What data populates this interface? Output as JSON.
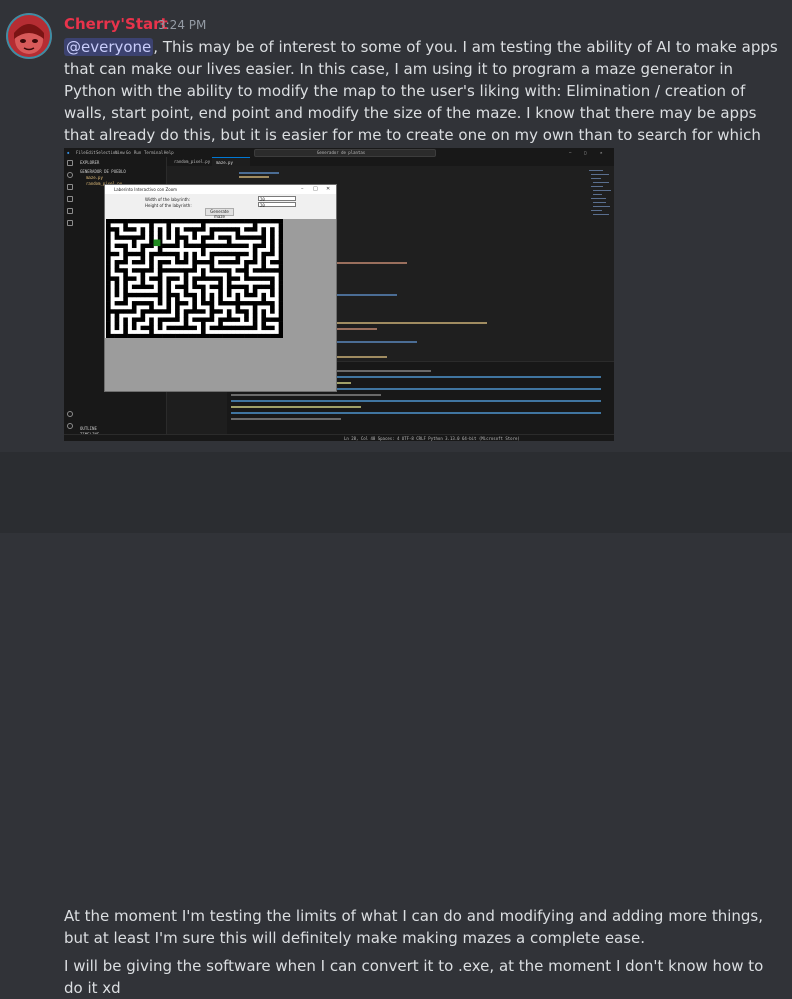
{
  "message1": {
    "author": "Cherry'Start",
    "timestamp": "3:24 PM",
    "author_color": "#e8334b",
    "mention": "@everyone",
    "text": ", This may be of interest to some of you. I am testing the ability of AI to make apps that can make our lives easier. In this case, I am using it to program a maze generator in Python with the ability to modify the map to the user's liking with: Elimination / creation of walls, start point, end point and modify the size of the maze. I know that there may be apps that already do this, but it is easier for me to create one on my own than to search for which one is most useful."
  },
  "attachment": {
    "title_menu": [
      "File",
      "Edit",
      "Selection",
      "View",
      "Go",
      "Run",
      "Terminal",
      "Help"
    ],
    "command_center": "Generador de plantas",
    "sidebar_title": "EXPLORER",
    "sidebar_folder": "GENERADOR DE PUEBLO",
    "sidebar_files": [
      "maze.py",
      "random_pixel.py"
    ],
    "sidebar_bottom": [
      "OUTLINE",
      "TIMELINE"
    ],
    "tabs": [
      "random_pixel.py",
      "maze.py"
    ],
    "tk_title": "Laberinto Interactivo con Zoom",
    "tk_width_label": "Width of the labyrinth:",
    "tk_height_label": "Height of the labyrinth:",
    "tk_width_value": "20",
    "tk_height_value": "20",
    "tk_button": "Generate maze",
    "status_right": "Ln 28, Col 48   Spaces: 4   UTF-8   CRLF   Python   3.13.0 64-bit (Microsoft Store)"
  },
  "message2": {
    "line1": "At the moment I'm testing the limits of what I can do and modifying and adding more things, but at least I'm sure this will definitely make making mazes a complete ease.",
    "line2": "I will be giving the software when I can convert it to .exe, at the moment I don't know how to do it xd"
  }
}
